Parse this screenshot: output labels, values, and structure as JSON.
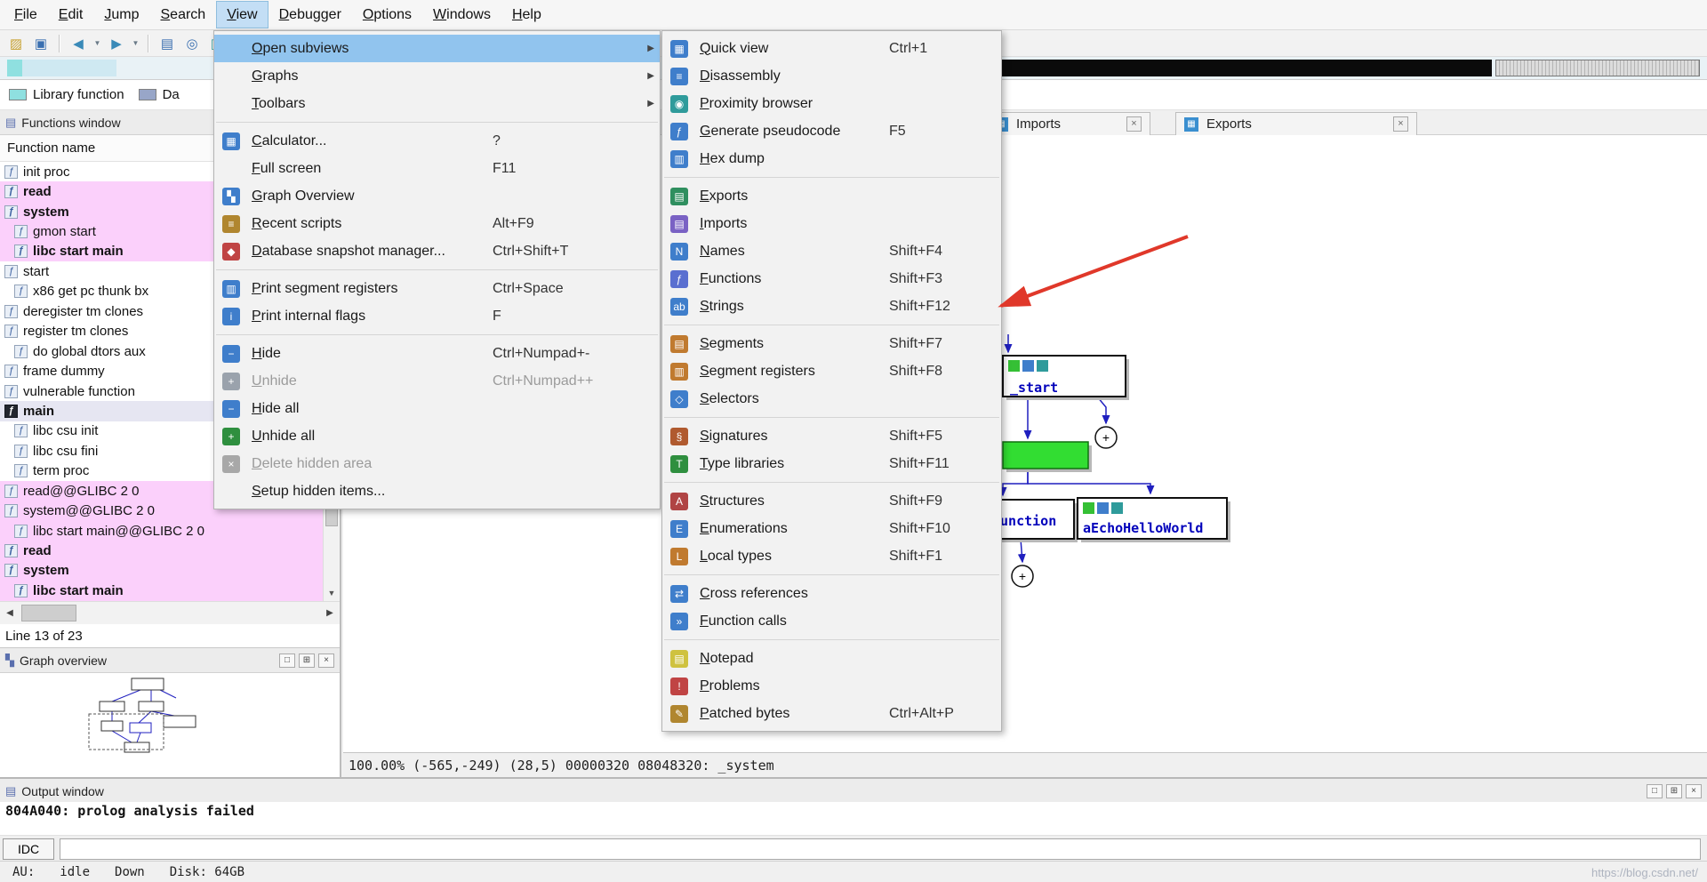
{
  "menubar": {
    "items": [
      "File",
      "Edit",
      "Jump",
      "Search",
      "View",
      "Debugger",
      "Options",
      "Windows",
      "Help"
    ],
    "active": "View"
  },
  "toolbar": [
    {
      "name": "open-file-icon",
      "glyph": "▨",
      "color": "#c8a232"
    },
    {
      "name": "save-file-icon",
      "glyph": "▣",
      "color": "#3a6fb0"
    },
    {
      "name": "separator"
    },
    {
      "name": "navigate-back-icon",
      "glyph": "◀",
      "color": "#3a8ab8"
    },
    {
      "name": "navigate-back-dropdown-icon",
      "glyph": "▼",
      "color": "#6a7a88",
      "small": true
    },
    {
      "name": "navigate-forward-icon",
      "glyph": "▶",
      "color": "#3a8ab8"
    },
    {
      "name": "navigate-forward-dropdown-icon",
      "glyph": "▼",
      "color": "#6a7a88",
      "small": true
    },
    {
      "name": "separator"
    },
    {
      "name": "jump-address-icon",
      "glyph": "▤",
      "color": "#3a6fb0"
    },
    {
      "name": "search-icon",
      "glyph": "◎",
      "color": "#3a6fb0"
    },
    {
      "name": "library-icon",
      "glyph": "▥",
      "color": "#2f9b9b"
    }
  ],
  "navband": {
    "segments": [
      {
        "start": 0.004,
        "width": 0.009,
        "color": "#8fe0e0"
      },
      {
        "start": 0.013,
        "width": 0.055,
        "color": "#cfe9f2"
      },
      {
        "start": 0.587,
        "width": 0.287,
        "color": "#0b0b0b"
      },
      {
        "start": 0.876,
        "width": 0.12,
        "color": "#dcdcdc",
        "striped": true
      }
    ]
  },
  "legend": [
    {
      "label": "Library function",
      "color": "#8fe0e0"
    },
    {
      "label": "Da",
      "color": "#98a6c8"
    }
  ],
  "functions_window": {
    "title": "Functions window",
    "titlebar_icon": "▤",
    "column_header": "Function name",
    "icon_glyph": "ƒ",
    "status": "Line 13 of 23",
    "rows": [
      {
        "label": "init proc"
      },
      {
        "label": "read",
        "bold": true,
        "pink": true
      },
      {
        "label": "system",
        "bold": true,
        "pink": true
      },
      {
        "label": "gmon start",
        "pink": true,
        "indent": true
      },
      {
        "label": "libc start main",
        "bold": true,
        "pink": true,
        "indent": true
      },
      {
        "label": "start"
      },
      {
        "label": "x86 get pc thunk bx",
        "indent": true
      },
      {
        "label": "deregister tm clones"
      },
      {
        "label": "register tm clones"
      },
      {
        "label": "do global dtors aux",
        "indent": true
      },
      {
        "label": "frame dummy"
      },
      {
        "label": "vulnerable function"
      },
      {
        "label": "main",
        "bold": true,
        "selected": true,
        "dark_icon": true
      },
      {
        "label": "libc csu init",
        "indent": true
      },
      {
        "label": "libc csu fini",
        "indent": true
      },
      {
        "label": "term proc",
        "indent": true
      },
      {
        "label": "read@@GLIBC 2 0",
        "pink": true
      },
      {
        "label": "system@@GLIBC 2 0",
        "pink": true
      },
      {
        "label": "libc start main@@GLIBC 2 0",
        "pink": true,
        "indent": true
      },
      {
        "label": "read",
        "bold": true,
        "pink": true
      },
      {
        "label": "system",
        "bold": true,
        "pink": true
      },
      {
        "label": "libc start main",
        "bold": true,
        "pink": true,
        "indent": true
      }
    ]
  },
  "graph_overview": {
    "title": "Graph overview",
    "titlebar_icon": "▚"
  },
  "window_controls": {
    "maximize": "□",
    "float": "⊞",
    "close": "×"
  },
  "scroll_icons": {
    "up": "▲",
    "down": "▼",
    "left": "◀",
    "right": "▶"
  },
  "tabs": {
    "imports": {
      "label": "Imports"
    },
    "exports": {
      "label": "Exports"
    }
  },
  "view_menu": {
    "items": [
      {
        "label": "Open subviews",
        "submenu": true,
        "highlighted": true
      },
      {
        "label": "Graphs",
        "submenu": true
      },
      {
        "label": "Toolbars",
        "submenu": true,
        "sep_after": true
      },
      {
        "label": "Calculator...",
        "shortcut": "?",
        "icon": "calculator-icon",
        "icon_glyph": "▦",
        "icon_bg": "#3f7ecb"
      },
      {
        "label": "Full screen",
        "shortcut": "F11"
      },
      {
        "label": "Graph Overview",
        "icon": "graph-overview-icon",
        "icon_glyph": "▚",
        "icon_bg": "#3f7ecb"
      },
      {
        "label": "Recent scripts",
        "shortcut": "Alt+F9",
        "icon": "recent-scripts-icon",
        "icon_glyph": "≡",
        "icon_bg": "#b0862f"
      },
      {
        "label": "Database snapshot manager...",
        "shortcut": "Ctrl+Shift+T",
        "icon": "snapshot-manager-icon",
        "icon_glyph": "◆",
        "icon_bg": "#c04444",
        "sep_after": true
      },
      {
        "label": "Print segment registers",
        "shortcut": "Ctrl+Space",
        "icon": "print-segment-registers-icon",
        "icon_glyph": "▥",
        "icon_bg": "#3f7ecb"
      },
      {
        "label": "Print internal flags",
        "shortcut": "F",
        "icon": "print-internal-flags-icon",
        "icon_glyph": "i",
        "icon_bg": "#3f7ecb",
        "sep_after": true
      },
      {
        "label": "Hide",
        "shortcut": "Ctrl+Numpad+-",
        "icon": "hide-icon",
        "icon_glyph": "−",
        "icon_bg": "#3f7ecb"
      },
      {
        "label": "Unhide",
        "shortcut": "Ctrl+Numpad++",
        "icon": "unhide-icon",
        "icon_glyph": "+",
        "icon_bg": "#9aa2ac",
        "disabled": true
      },
      {
        "label": "Hide all",
        "icon": "hide-all-icon",
        "icon_glyph": "−",
        "icon_bg": "#3f7ecb"
      },
      {
        "label": "Unhide all",
        "icon": "unhide-all-icon",
        "icon_glyph": "+",
        "icon_bg": "#2f8f3f"
      },
      {
        "label": "Delete hidden area",
        "icon": "delete-hidden-area-icon",
        "icon_glyph": "×",
        "icon_bg": "#a8a8a8",
        "disabled": true
      },
      {
        "label": "Setup hidden items..."
      }
    ]
  },
  "subviews_menu": {
    "items": [
      {
        "label": "Quick view",
        "shortcut": "Ctrl+1",
        "icon": "quick-view-icon",
        "icon_glyph": "▦",
        "icon_bg": "#3f7ecb"
      },
      {
        "label": "Disassembly",
        "icon": "disassembly-icon",
        "icon_glyph": "≡",
        "icon_bg": "#3f7ecb"
      },
      {
        "label": "Proximity browser",
        "icon": "proximity-browser-icon",
        "icon_glyph": "◉",
        "icon_bg": "#2f9b9b"
      },
      {
        "label": "Generate pseudocode",
        "shortcut": "F5",
        "icon": "pseudocode-icon",
        "icon_glyph": "ƒ",
        "icon_bg": "#3f7ecb"
      },
      {
        "label": "Hex dump",
        "icon": "hex-dump-icon",
        "icon_glyph": "▥",
        "icon_bg": "#3f7ecb",
        "sep_after": true
      },
      {
        "label": "Exports",
        "icon": "exports-icon",
        "icon_glyph": "▤",
        "icon_bg": "#2f8f5f"
      },
      {
        "label": "Imports",
        "icon": "imports-icon",
        "icon_glyph": "▤",
        "icon_bg": "#7a62c4"
      },
      {
        "label": "Names",
        "shortcut": "Shift+F4",
        "icon": "names-icon",
        "icon_glyph": "N",
        "icon_bg": "#3f7ecb"
      },
      {
        "label": "Functions",
        "shortcut": "Shift+F3",
        "icon": "functions-icon",
        "icon_glyph": "ƒ",
        "icon_bg": "#5a6fd0"
      },
      {
        "label": "Strings",
        "shortcut": "Shift+F12",
        "icon": "strings-icon",
        "icon_glyph": "ab",
        "icon_bg": "#3f7ecb",
        "sep_after": true
      },
      {
        "label": "Segments",
        "shortcut": "Shift+F7",
        "icon": "segments-icon",
        "icon_glyph": "▤",
        "icon_bg": "#c07a2f"
      },
      {
        "label": "Segment registers",
        "shortcut": "Shift+F8",
        "icon": "segment-registers-icon",
        "icon_glyph": "▥",
        "icon_bg": "#c07a2f"
      },
      {
        "label": "Selectors",
        "icon": "selectors-icon",
        "icon_glyph": "◇",
        "icon_bg": "#3f7ecb",
        "sep_after": true
      },
      {
        "label": "Signatures",
        "shortcut": "Shift+F5",
        "icon": "signatures-icon",
        "icon_glyph": "§",
        "icon_bg": "#b05a2f"
      },
      {
        "label": "Type libraries",
        "shortcut": "Shift+F11",
        "icon": "type-libraries-icon",
        "icon_glyph": "T",
        "icon_bg": "#2f8f3f",
        "sep_after": true
      },
      {
        "label": "Structures",
        "shortcut": "Shift+F9",
        "icon": "structures-icon",
        "icon_glyph": "A",
        "icon_bg": "#b04444"
      },
      {
        "label": "Enumerations",
        "shortcut": "Shift+F10",
        "icon": "enumerations-icon",
        "icon_glyph": "E",
        "icon_bg": "#3f7ecb"
      },
      {
        "label": "Local types",
        "shortcut": "Shift+F1",
        "icon": "local-types-icon",
        "icon_glyph": "L",
        "icon_bg": "#c07a2f",
        "sep_after": true
      },
      {
        "label": "Cross references",
        "icon": "cross-references-icon",
        "icon_glyph": "⇄",
        "icon_bg": "#3f7ecb"
      },
      {
        "label": "Function calls",
        "icon": "function-calls-icon",
        "icon_glyph": "»",
        "icon_bg": "#3f7ecb",
        "sep_after": true
      },
      {
        "label": "Notepad",
        "icon": "notepad-icon",
        "icon_glyph": "▤",
        "icon_bg": "#cfc23f"
      },
      {
        "label": "Problems",
        "icon": "problems-icon",
        "icon_glyph": "!",
        "icon_bg": "#c04444"
      },
      {
        "label": "Patched bytes",
        "shortcut": "Ctrl+Alt+P",
        "icon": "patched-bytes-icon",
        "icon_glyph": "✎",
        "icon_bg": "#b0862f"
      }
    ]
  },
  "graph": {
    "edge_color": "#1f1fbf",
    "label_color": "#0000bb",
    "expand_icon": "+",
    "nodes": [
      {
        "id": "start-node",
        "label": "_start"
      },
      {
        "id": "current-node",
        "label": "",
        "color": "#32dd32"
      },
      {
        "id": "function-node",
        "label": "function"
      },
      {
        "id": "string-node",
        "label": "aEchoHelloWorld"
      }
    ]
  },
  "status_line": "100.00% (-565,-249) (28,5) 00000320 08048320: _system",
  "output_window": {
    "title": "Output window",
    "titlebar_icon": "▤",
    "line": "804A040: prolog analysis failed",
    "idc_label": "IDC"
  },
  "statusbar": {
    "au_label": "AU:",
    "au_value": "idle",
    "indicator": "Down",
    "disk": "Disk: 64GB"
  },
  "annotation": {
    "color": "#e0382a"
  },
  "watermark": "https://blog.csdn.net/"
}
